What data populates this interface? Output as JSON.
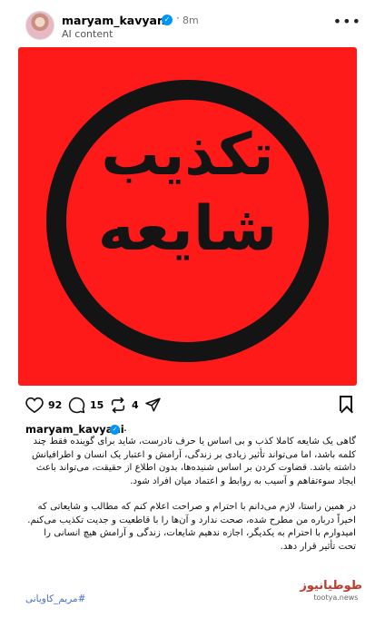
{
  "post": {
    "username": "maryam_kavyani",
    "time": "8m",
    "label": "AI content",
    "more_icon": "•••"
  },
  "media": {
    "stamp_line1": "تکذیب",
    "stamp_line2": "شایعه",
    "background_color": "#ff1a1a",
    "stamp_color": "#141414"
  },
  "actions": {
    "likes": "92",
    "comments": "15",
    "reposts": "4"
  },
  "caption": {
    "username": "maryam_kavyani",
    "paragraph1": "گاهی یک شایعه کاملا کذب و بی اساس یا حرف نادرست، شاید برای گوینده فقط چند کلمه باشد، اما می‌تواند تأثیر زیادی بر زندگی، آرامش و اعتبار یک انسان و اطرافیانش داشته باشد. قضاوت کردن بر اساس شنیده‌ها، بدون اطلاع از حقیقت، می‌تواند باعث ایجاد سوءتفاهم و آسیب به روابط و اعتماد میان افراد شود.",
    "paragraph2": "در همین راستا، لازم می‌دانم با احترام و صراحت اعلام کنم که مطالب و شایعاتی که اخیراً درباره من مطرح شده، صحت ندارد و آن‌ها را با قاطعیت و جدیت تکذیب می‌کنم.",
    "paragraph3": "امیدوارم با احترام به یکدیگر، اجازه ندهیم شایعات، زندگی و آرامش هیچ انسانی را تحت تأثیر قرار دهد.",
    "hashtag": "#مریم_کاویانی"
  },
  "watermark": {
    "logo": "طوطیانیوز",
    "url": "tootya.news"
  }
}
